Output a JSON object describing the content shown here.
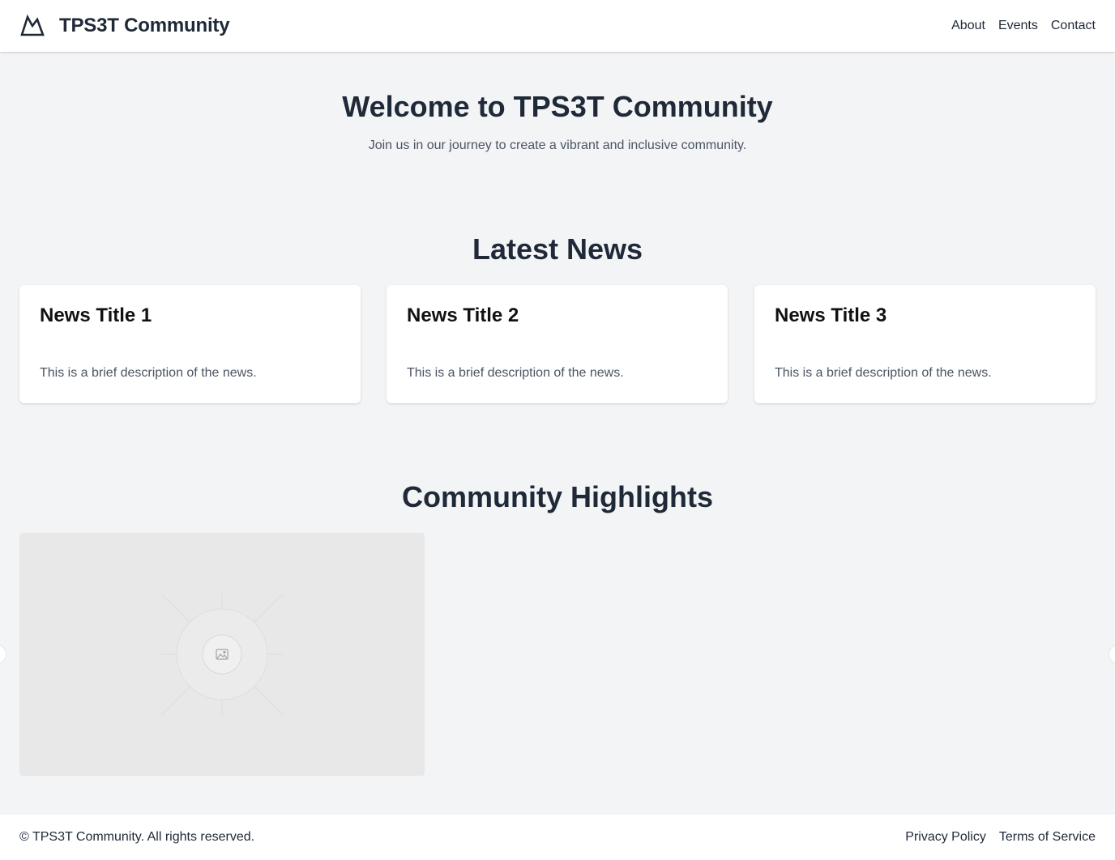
{
  "header": {
    "brand_name": "TPS3T Community",
    "logo_icon": "mountain-icon",
    "nav": [
      {
        "label": "About"
      },
      {
        "label": "Events"
      },
      {
        "label": "Contact"
      }
    ]
  },
  "hero": {
    "title": "Welcome to TPS3T Community",
    "subtitle": "Join us in our journey to create a vibrant and inclusive community."
  },
  "news": {
    "heading": "Latest News",
    "items": [
      {
        "title": "News Title 1",
        "description": "This is a brief description of the news."
      },
      {
        "title": "News Title 2",
        "description": "This is a brief description of the news."
      },
      {
        "title": "News Title 3",
        "description": "This is a brief description of the news."
      }
    ]
  },
  "highlights": {
    "heading": "Community Highlights",
    "slide_icon": "image-placeholder-icon"
  },
  "footer": {
    "copyright": "© TPS3T Community. All rights reserved.",
    "links": [
      {
        "label": "Privacy Policy"
      },
      {
        "label": "Terms of Service"
      }
    ]
  },
  "colors": {
    "page_background": "#f3f4f6",
    "surface": "#ffffff",
    "text_primary": "#1f2937",
    "text_secondary": "#4b5563",
    "placeholder": "#e8e8e8"
  }
}
